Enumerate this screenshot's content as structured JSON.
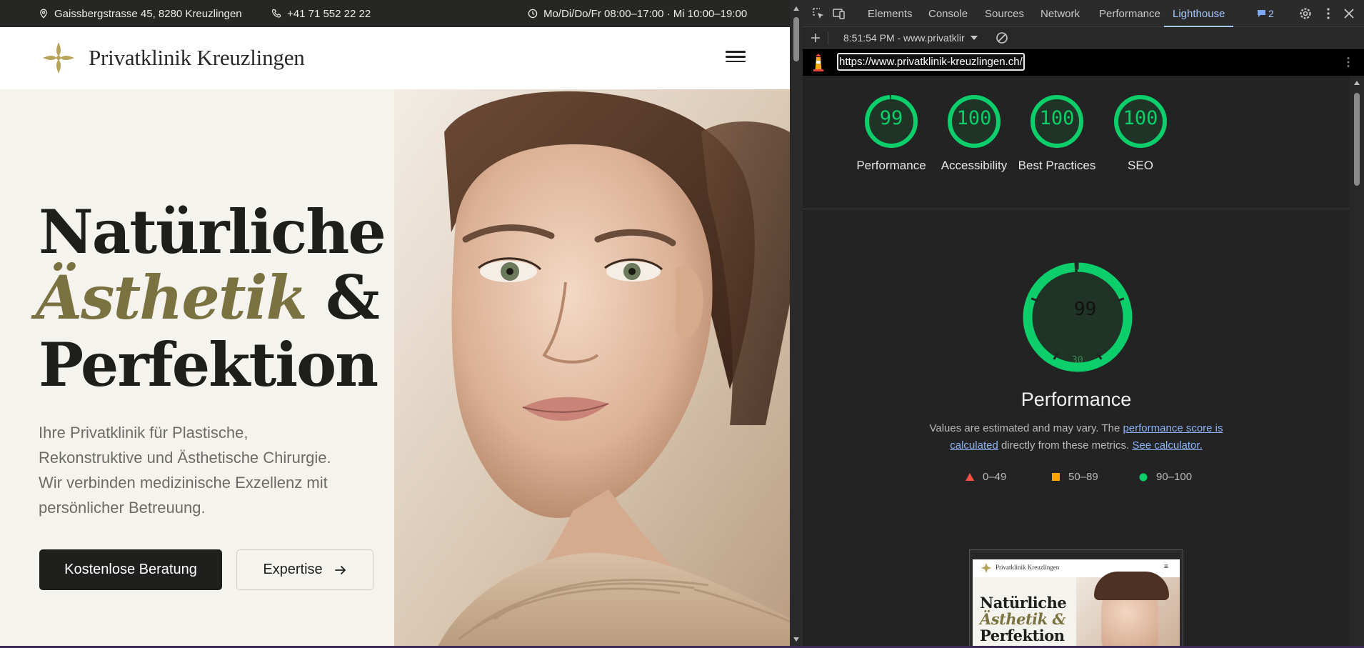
{
  "topbar": {
    "address": "Gaissbergstrasse 45, 8280 Kreuzlingen",
    "phone": "+41 71 552 22 22",
    "hours": "Mo/Di/Do/Fr 08:00–17:00 · Mi 10:00–19:00"
  },
  "header": {
    "brand": "Privatklinik Kreuzlingen"
  },
  "hero": {
    "title_line1": "Natürliche",
    "title_line2_em": "Ästhetik",
    "title_line2_rest": " &",
    "title_line3": "Perfektion",
    "lead": "Ihre Privatklinik für Plastische, Rekonstruktive und Ästhetische Chirurgie. Wir verbinden medizinische Exzellenz mit persönlicher Betreuung.",
    "primary_button": "Kostenlose Beratung",
    "secondary_button": "Expertise"
  },
  "devtools": {
    "tabs": [
      "Elements",
      "Console",
      "Sources",
      "Network",
      "Performance",
      "Lighthouse"
    ],
    "active_tab": "Lighthouse",
    "issues_count": "2",
    "report_label": "8:51:54 PM - www.privatklir",
    "url": "https://www.privatklinik-kreuzlingen.ch/",
    "scores": [
      {
        "label": "Performance",
        "value": "99",
        "fraction": 0.99
      },
      {
        "label": "Accessibility",
        "value": "100",
        "fraction": 1.0
      },
      {
        "label": "Best Practices",
        "value": "100",
        "fraction": 1.0
      },
      {
        "label": "SEO",
        "value": "100",
        "fraction": 1.0
      }
    ],
    "big_score": "99",
    "big_score_small": "30",
    "perf_title": "Performance",
    "desc_prefix": "Values are estimated and may vary. The ",
    "desc_link1": "performance score is calculated",
    "desc_mid": " directly from these metrics. ",
    "desc_link2": "See calculator.",
    "legend": [
      {
        "range": "0–49",
        "color": "#ff4e42"
      },
      {
        "range": "50–89",
        "color": "#ffa400"
      },
      {
        "range": "90–100",
        "color": "#0cce6b"
      }
    ],
    "thumb": {
      "brand": "Privatklinik Kreuzlingen",
      "line1": "Natürliche",
      "line2": "Ästhetik &",
      "line3": "Perfektion"
    }
  },
  "colors": {
    "accent_gold": "#7a7240",
    "score_green": "#0cce6b",
    "link_blue": "#8ab4f8"
  }
}
